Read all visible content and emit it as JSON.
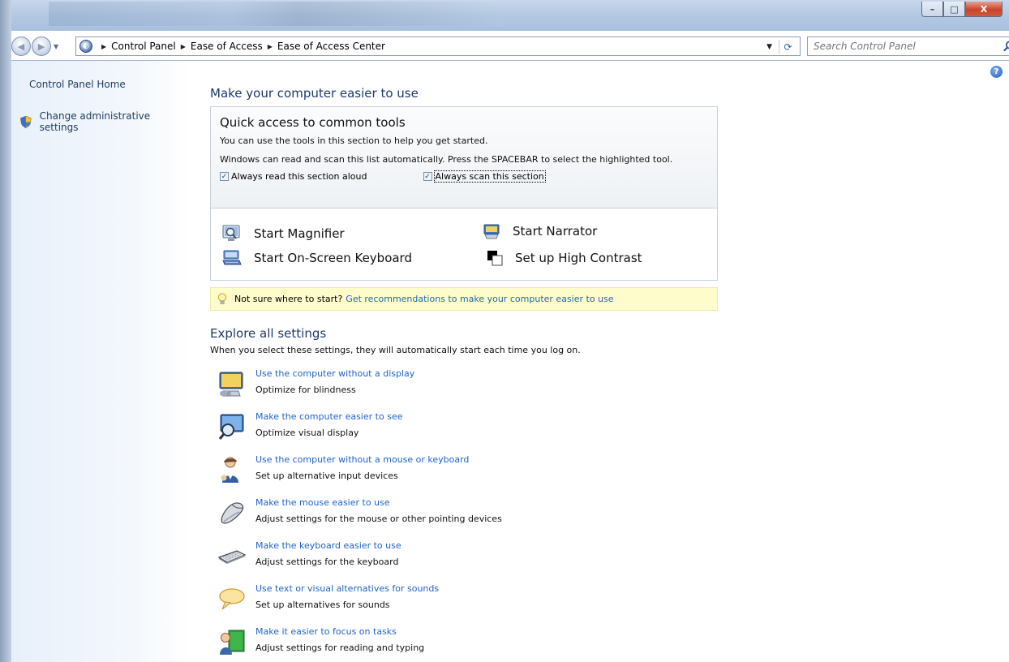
{
  "window": {
    "minimize": "–",
    "maximize": "□",
    "close": "X"
  },
  "address": {
    "crumbs": [
      "Control Panel",
      "Ease of Access",
      "Ease of Access Center"
    ],
    "search_placeholder": "Search Control Panel"
  },
  "sidebar": {
    "home": "Control Panel Home",
    "admin": "Change administrative settings"
  },
  "main": {
    "title": "Make your computer easier to use",
    "quick": {
      "title": "Quick access to common tools",
      "line1": "You can use the tools in this section to help you get started.",
      "line2": "Windows can read and scan this list automatically.  Press the SPACEBAR to select the highlighted tool.",
      "check_read": "Always read this section aloud",
      "check_scan": "Always scan this section",
      "tools": {
        "magnifier": "Start Magnifier",
        "narrator": "Start Narrator",
        "keyboard": "Start On-Screen Keyboard",
        "contrast": "Set up High Contrast"
      }
    },
    "tip": {
      "text": "Not sure where to start?",
      "link": "Get recommendations to make your computer easier to use"
    },
    "explore": {
      "title": "Explore all settings",
      "desc": "When you select these settings, they will automatically start each time you log on.",
      "items": [
        {
          "link": "Use the computer without a display",
          "sub": "Optimize for blindness",
          "icon": "monitor-blind-icon"
        },
        {
          "link": "Make the computer easier to see",
          "sub": "Optimize visual display",
          "icon": "monitor-magnifier-icon"
        },
        {
          "link": "Use the computer without a mouse or keyboard",
          "sub": "Set up alternative input devices",
          "icon": "person-speech-icon"
        },
        {
          "link": "Make the mouse easier to use",
          "sub": "Adjust settings for the mouse or other pointing devices",
          "icon": "mouse-icon"
        },
        {
          "link": "Make the keyboard easier to use",
          "sub": "Adjust settings for the keyboard",
          "icon": "keyboard-icon"
        },
        {
          "link": "Use text or visual alternatives for sounds",
          "sub": "Set up alternatives for sounds",
          "icon": "speech-bubble-icon"
        },
        {
          "link": "Make it easier to focus on tasks",
          "sub": "Adjust settings for reading and typing",
          "icon": "person-book-icon"
        }
      ]
    }
  }
}
